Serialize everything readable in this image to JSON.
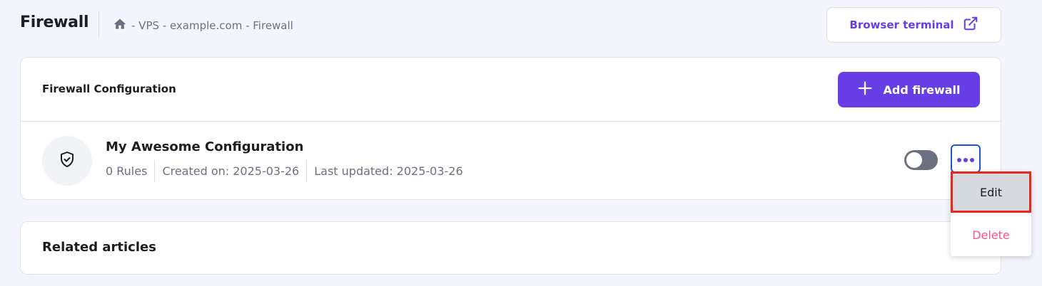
{
  "header": {
    "title": "Firewall",
    "breadcrumb": "- VPS - example.com - Firewall",
    "terminal_label": "Browser terminal"
  },
  "card": {
    "title": "Firewall Configuration",
    "add_label": "Add firewall"
  },
  "config": {
    "name": "My Awesome Configuration",
    "rules": "0 Rules",
    "created": "Created on: 2025-03-26",
    "updated": "Last updated: 2025-03-26",
    "enabled": false
  },
  "menu": {
    "edit_label": "Edit",
    "delete_label": "Delete"
  },
  "related": {
    "title": "Related articles"
  },
  "colors": {
    "accent": "#673de6",
    "danger": "#fc5185",
    "highlight": "#e8281d"
  }
}
